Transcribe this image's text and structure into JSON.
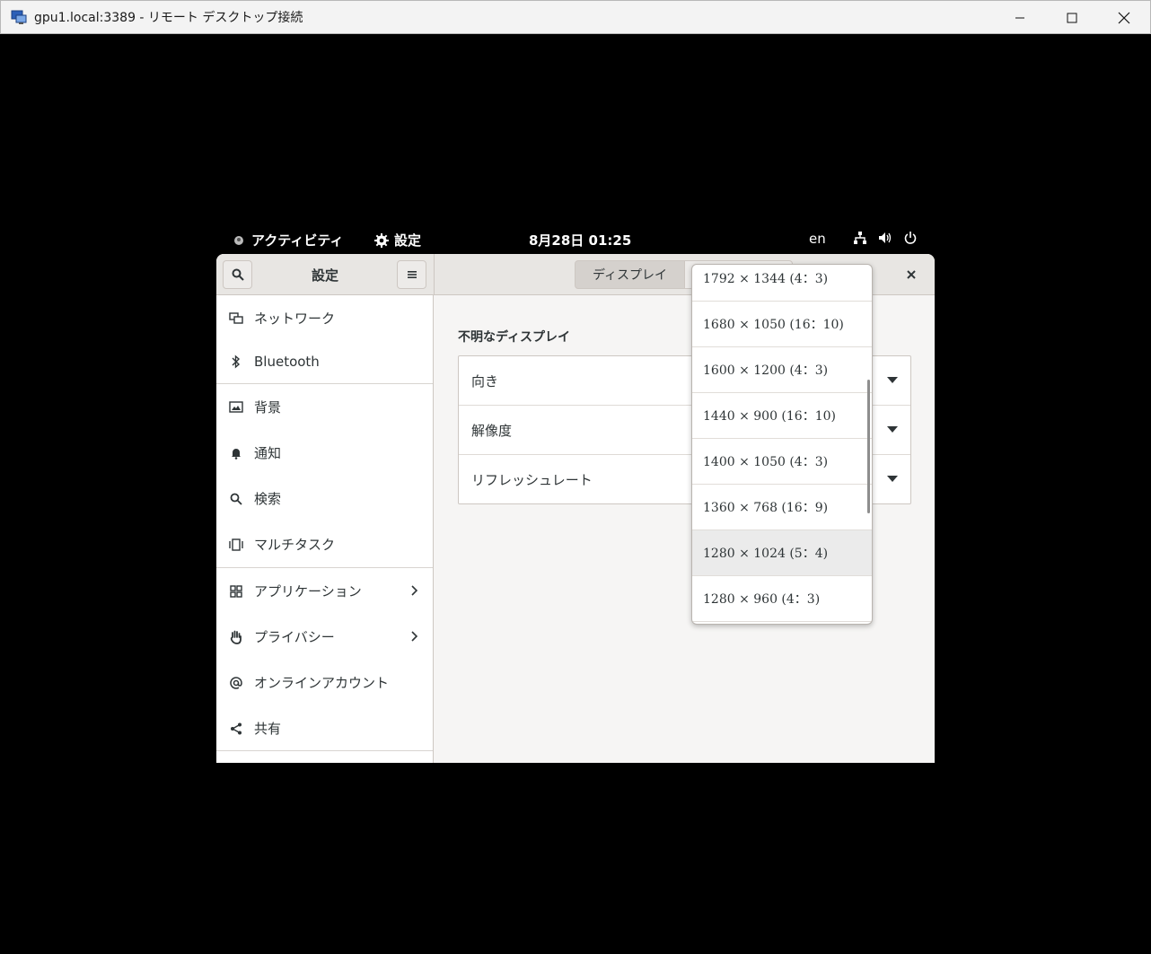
{
  "window": {
    "title": "gpu1.local:3389 - リモート デスクトップ接続",
    "minimize": "─",
    "maximize": "☐",
    "close": "✕"
  },
  "topbar": {
    "activities": "アクティビティ",
    "app_name": "設定",
    "clock": "8月28日  01:25",
    "lang": "en"
  },
  "settings": {
    "header_title": "設定",
    "stack_tab": "ディスプレイ",
    "close": "✕"
  },
  "sidebar": {
    "items": [
      {
        "label": "ネットワーク",
        "icon": "network-icon"
      },
      {
        "label": "Bluetooth",
        "icon": "bluetooth-icon"
      },
      {
        "label": "背景",
        "icon": "background-icon"
      },
      {
        "label": "通知",
        "icon": "bell-icon"
      },
      {
        "label": "検索",
        "icon": "search-icon"
      },
      {
        "label": "マルチタスク",
        "icon": "multitask-icon"
      },
      {
        "label": "アプリケーション",
        "icon": "apps-icon"
      },
      {
        "label": "プライバシー",
        "icon": "hand-icon"
      },
      {
        "label": "オンラインアカウント",
        "icon": "at-icon"
      },
      {
        "label": "共有",
        "icon": "share-icon"
      }
    ]
  },
  "display": {
    "heading": "不明なディスプレイ",
    "rows": [
      {
        "label": "向き"
      },
      {
        "label": "解像度"
      },
      {
        "label": "リフレッシュレート"
      }
    ]
  },
  "resolution_popover": {
    "options": [
      "1792 × 1344 (4：3)",
      "1680 × 1050 (16：10)",
      "1600 × 1200 (4：3)",
      "1440 × 900 (16：10)",
      "1400 × 1050 (4：3)",
      "1360 × 768 (16：9)",
      "1280 × 1024 (5：4)",
      "1280 × 960 (4：3)"
    ],
    "highlighted_index": 6
  }
}
